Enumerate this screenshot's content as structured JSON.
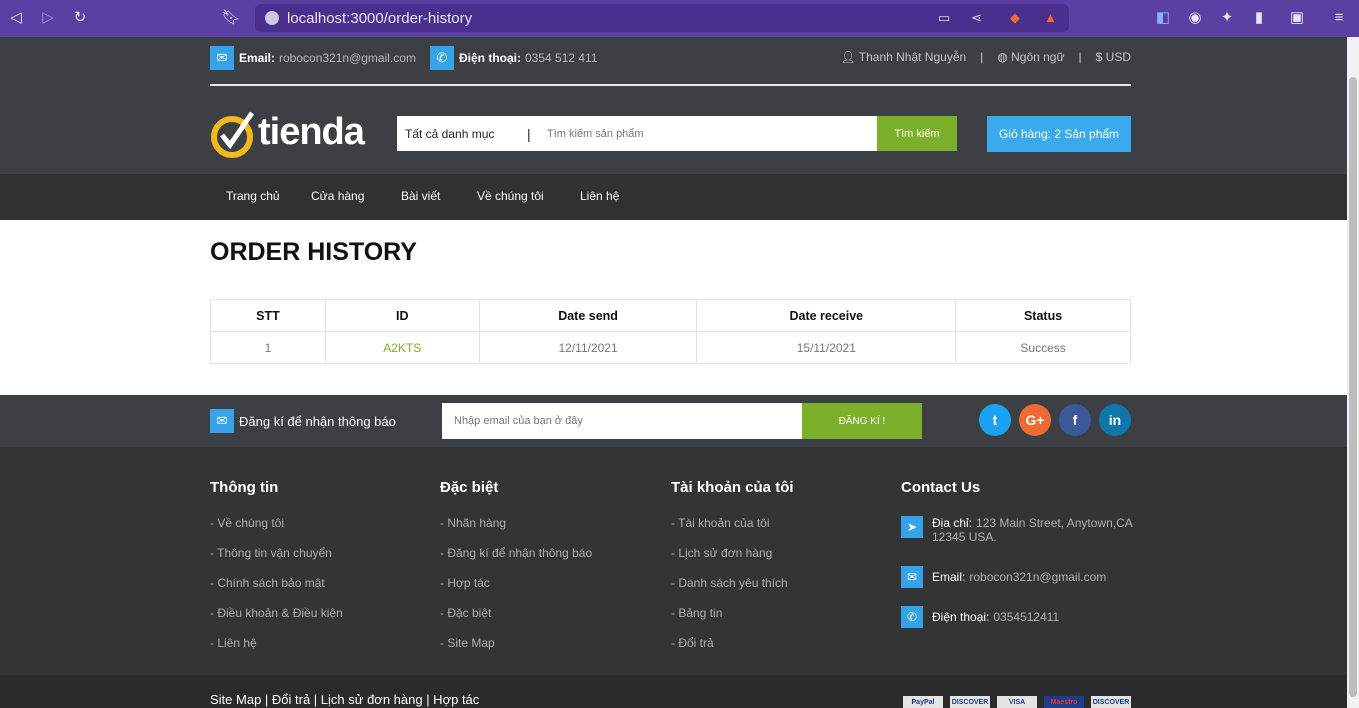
{
  "browser": {
    "url": "localhost:3000/order-history",
    "badge": "1"
  },
  "topinfo": {
    "email_label": "Email:",
    "email": "robocon321n@gmail.com",
    "phone_label": "Điện thoại:",
    "phone": "0354 512 411",
    "user": "Thanh Nhật Nguyễn",
    "language": "Ngôn ngữ",
    "currency": "USD"
  },
  "logo": "tienda",
  "search": {
    "category": "Tất cả danh mục",
    "placeholder": "Tìm kiếm sản phẩm",
    "button": "Tìm kiếm"
  },
  "cart": "Giỏ hàng: 2 Sản phẩm",
  "nav": [
    "Trang chủ",
    "Cửa hàng",
    "Bài viết",
    "Về chúng tôi",
    "Liên hệ"
  ],
  "page_title": "ORDER HISTORY",
  "table": {
    "headers": [
      "STT",
      "ID",
      "Date send",
      "Date receive",
      "Status"
    ],
    "rows": [
      [
        "1",
        "A2KTS",
        "12/11/2021",
        "15/11/2021",
        "Success"
      ]
    ]
  },
  "newsletter": {
    "label": "Đăng kí để nhận thông báo",
    "placeholder": "Nhập email của bạn ở đây",
    "button": "ĐĂNG KÍ !"
  },
  "social": [
    "twitter-icon",
    "google-plus-icon",
    "facebook-icon",
    "linkedin-icon"
  ],
  "footer": {
    "col1": {
      "title": "Thông tin",
      "items": [
        "- Về chúng tôi",
        "- Thông tin vận chuyển",
        "- Chính sách bảo mật",
        "- Điều khoản & Điều kiện",
        "- Liên hệ"
      ]
    },
    "col2": {
      "title": "Đặc biệt",
      "items": [
        "- Nhãn hàng",
        "- Đăng kí để nhận thông báo",
        "- Hợp tác",
        "- Đặc biệt",
        "- Site Map"
      ]
    },
    "col3": {
      "title": "Tài khoản của tôi",
      "items": [
        "- Tài khoản của tôi",
        "- Lịch sử đơn hàng",
        "- Danh sách yêu thích",
        "- Bảng tin",
        "- Đổi trả"
      ]
    },
    "contact": {
      "title": "Contact Us",
      "address_label": "Địa chỉ:",
      "address": "123 Main Street, Anytown,CA 12345 USA.",
      "email_label": "Email:",
      "email": "robocon321n@gmail.com",
      "phone_label": "Điện thoại:",
      "phone": "0354512411"
    }
  },
  "bottom_links": "Site Map | Đổi trả | Lịch sử đơn hàng | Hợp tác",
  "payments": [
    "PayPal",
    "DISCOVER",
    "VISA",
    "Maestro",
    "DISCOVER"
  ]
}
